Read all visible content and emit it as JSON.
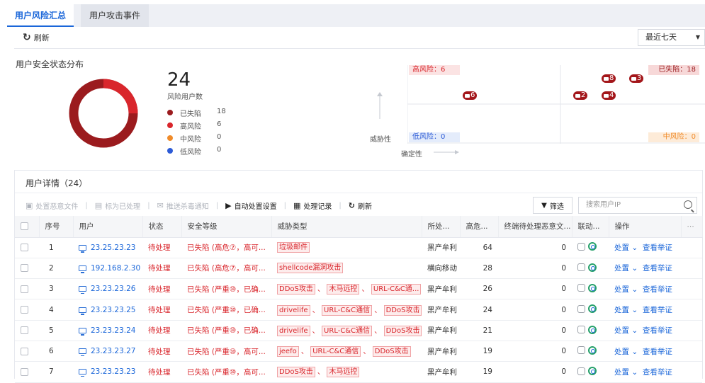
{
  "tabs": [
    "用户风险汇总",
    "用户攻击事件"
  ],
  "toolbar": {
    "refresh": "刷新",
    "range": "最近七天"
  },
  "distribution": {
    "title": "用户安全状态分布",
    "total": "24",
    "total_label": "风险用户数",
    "legend": [
      {
        "name": "已失陷",
        "value": "18",
        "color": "#9b1b1e"
      },
      {
        "name": "高风险",
        "value": "6",
        "color": "#d9262c"
      },
      {
        "name": "中风险",
        "value": "0",
        "color": "#f08b2a"
      },
      {
        "name": "低风险",
        "value": "0",
        "color": "#2d5bd6"
      }
    ]
  },
  "matrix": {
    "q_high": "高风险：6",
    "q_lost": "已失陷：18",
    "q_low": "低风险：0",
    "q_mid": "中风险：0",
    "y_axis": "威胁性",
    "x_axis": "确定性",
    "bubbles": [
      "6",
      "8",
      "3",
      "2",
      "4"
    ]
  },
  "details": {
    "title": "用户详情（24）",
    "ops": [
      "处置恶意文件",
      "标为已处理",
      "推送杀毒通知",
      "自动处置设置",
      "处理记录",
      "刷新"
    ],
    "filter": "筛选",
    "search_placeholder": "搜索用户IP",
    "columns": [
      "序号",
      "用户",
      "状态",
      "安全等级",
      "威胁类型",
      "所处...",
      "高危...",
      "终端待处理恶意文...",
      "联动...",
      "操作"
    ],
    "rows": [
      {
        "no": "1",
        "ip": "23.25.23.23",
        "status": "待处理",
        "level": "已失陷 (高危⑦，高可...",
        "threats": [
          "垃圾邮件"
        ],
        "stage": "黑产牟利",
        "high": "64",
        "pending": "0"
      },
      {
        "no": "2",
        "ip": "192.168.2.30",
        "status": "待处理",
        "level": "已失陷 (高危⑦，高可...",
        "threats": [
          "shellcode漏洞攻击"
        ],
        "stage": "横向移动",
        "high": "28",
        "pending": "0"
      },
      {
        "no": "3",
        "ip": "23.23.23.26",
        "status": "待处理",
        "level": "已失陷 (严重⑩，已确...",
        "threats": [
          "DDoS攻击",
          "木马远控",
          "URL-C&C通..."
        ],
        "stage": "黑产牟利",
        "high": "26",
        "pending": "0"
      },
      {
        "no": "4",
        "ip": "23.23.23.25",
        "status": "待处理",
        "level": "已失陷 (严重⑩，已确...",
        "threats": [
          "drivelife",
          "URL-C&C通信",
          "DDoS攻击"
        ],
        "stage": "黑产牟利",
        "high": "24",
        "pending": "0"
      },
      {
        "no": "5",
        "ip": "23.23.23.24",
        "status": "待处理",
        "level": "已失陷 (严重⑩，已确...",
        "threats": [
          "drivelife",
          "URL-C&C通信",
          "DDoS攻击"
        ],
        "stage": "黑产牟利",
        "high": "21",
        "pending": "0"
      },
      {
        "no": "6",
        "ip": "23.23.23.27",
        "status": "待处理",
        "level": "已失陷 (严重⑩，高可...",
        "threats": [
          "jeefo",
          "URL-C&C通信",
          "DDoS攻击"
        ],
        "stage": "黑产牟利",
        "high": "19",
        "pending": "0"
      },
      {
        "no": "7",
        "ip": "23.23.23.23",
        "status": "待处理",
        "level": "已失陷 (严重⑩，高可...",
        "threats": [
          "DDoS攻击",
          "木马远控"
        ],
        "stage": "黑产牟利",
        "high": "19",
        "pending": "0"
      }
    ],
    "action_dispose": "处置",
    "action_evidence": "查看举证"
  }
}
